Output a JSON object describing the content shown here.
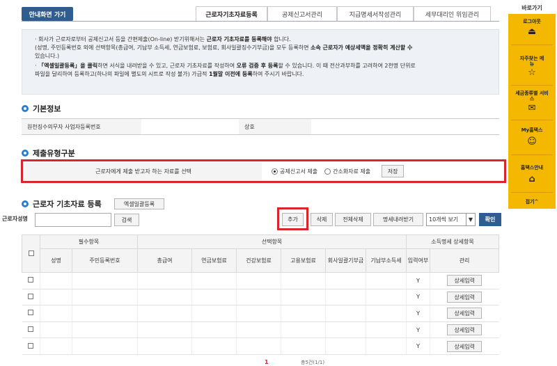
{
  "guide_button": "안내화면 가기",
  "tabs": [
    {
      "label": "근로자기초자료등록",
      "active": true
    },
    {
      "label": "공제신고서관리",
      "active": false
    },
    {
      "label": "지급명세서작성관리",
      "active": false
    },
    {
      "label": "세무대리인 위임관리",
      "active": false
    }
  ],
  "notice": {
    "line1_a": "· 회사가 근로자로부터 공제신고서 등을 간편제출(On-line) 받기위해서는 ",
    "line1_b": "근로자 기초자료를 등록해야",
    "line1_c": " 합니다.",
    "line2_a": "(성명, 주민등록번호 외에 선택항목(총급여, 기납부 소득세, 연금보험료, 보험료, 회사일괄징수기부금)을 모두 등록하면 ",
    "line2_b": "소속 근로자가 예상세액을 정확히 계산할 수",
    "line3": "있습니다.)",
    "line4_a": "· ",
    "line4_b": "「엑셀일괄등록」을 클릭",
    "line4_c": "하면 서식을 내려받을 수 있고, 근로자 기초자료를 작성하여 ",
    "line4_d": "오류 검증 후 등록",
    "line4_e": "할 수 있습니다. 이 때 전산과부하를 고려하여 2천명 단위로",
    "line5_a": "파일을 달리하여 등록하고(하나의 파일에 별도의 시트로 작성 불가) 가급적 ",
    "line5_b": "1월말 이전에 등록",
    "line5_c": "하여 주시기 바랍니다."
  },
  "basic_info": {
    "title": "기본정보",
    "biz_no_label": "원천징수의무자 사업자등록번호",
    "biz_no_value": "",
    "name_label": "상호",
    "name_value": ""
  },
  "submit_type": {
    "title": "제출유형구분",
    "label": "근로자에게 제출 받고자 하는 자료를 선택",
    "option1": "공제신고서 제출",
    "option2": "간소화자료 제출",
    "selected": "공제신고서 제출",
    "save": "저장"
  },
  "worker_section": {
    "title": "근로자 기초자료 등록",
    "excel_button": "엑셀일괄등록",
    "search_label": "근로자성명",
    "search_value": "",
    "search_button": "검색",
    "add_button": "추가",
    "delete_button": "삭제",
    "delete_all_button": "전체삭제",
    "download_button": "명세내려받기",
    "page_size": "10개씩 보기",
    "ok_button": "확인"
  },
  "table": {
    "group_required": "필수항목",
    "group_optional": "선택항목",
    "group_detail": "소득명세 상세항목",
    "columns": [
      "성명",
      "주민등록번호",
      "총급여",
      "연금보험료",
      "건강보험료",
      "고용보험료",
      "회사일괄기부금",
      "기납부소득세",
      "입력여부",
      "관리"
    ],
    "rows": [
      {
        "input": "Y",
        "action": "상세입력"
      },
      {
        "input": "Y",
        "action": "상세입력"
      },
      {
        "input": "Y",
        "action": "상세입력"
      },
      {
        "input": "Y",
        "action": "상세입력"
      },
      {
        "input": "Y",
        "action": "상세입력"
      }
    ]
  },
  "pager": {
    "current": "1",
    "total": "총5건(1/1)"
  },
  "sidebar": {
    "title": "바로가기",
    "items": [
      {
        "label": "로그아웃",
        "icon": "logout-icon"
      },
      {
        "label": "자주찾는 메뉴",
        "icon": "star-icon"
      },
      {
        "label": "세금종류별 서비스",
        "icon": "tax-icon"
      },
      {
        "label": "My홈택스",
        "icon": "person-icon"
      },
      {
        "label": "홈택스안내",
        "icon": "home-icon"
      }
    ],
    "close": "접기^"
  }
}
